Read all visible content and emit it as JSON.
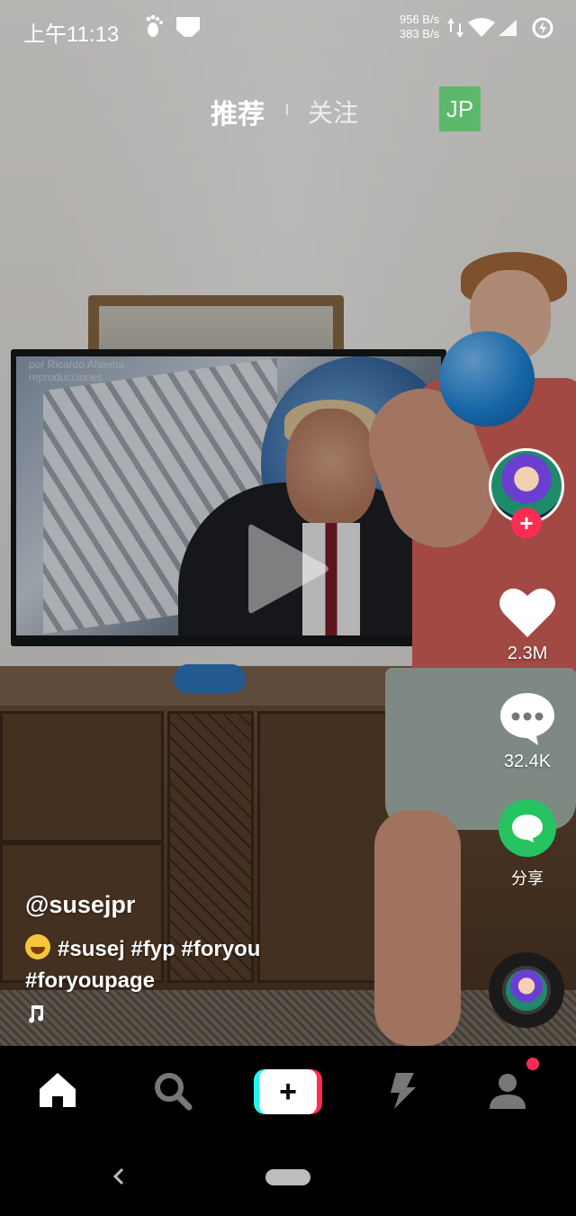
{
  "status_bar": {
    "time": "上午11:13",
    "speed_down": "956 B/s",
    "speed_up": "383 B/s"
  },
  "top_nav": {
    "tab_recommended": "推荐",
    "tab_following": "关注",
    "badge": "JP"
  },
  "video_overlay_text": {
    "tv_caption_line1": "por Ricardo Ahtema",
    "tv_caption_line2": "reproducciones"
  },
  "right_rail": {
    "likes": "2.3M",
    "comments": "32.4K",
    "share_label": "分享"
  },
  "caption": {
    "username": "@susejpr",
    "hashtags_line1": "#susej #fyp #foryou",
    "hashtags_line2": "#foryoupage"
  },
  "bottom_nav": {
    "items": [
      "home-icon",
      "search-icon",
      "create-plus-icon",
      "lightning-icon",
      "profile-icon"
    ]
  },
  "colors": {
    "accent_red": "#fe2c55",
    "accent_cyan": "#25f4ee",
    "share_green": "#25c460",
    "badge_green": "#5cb86a"
  }
}
